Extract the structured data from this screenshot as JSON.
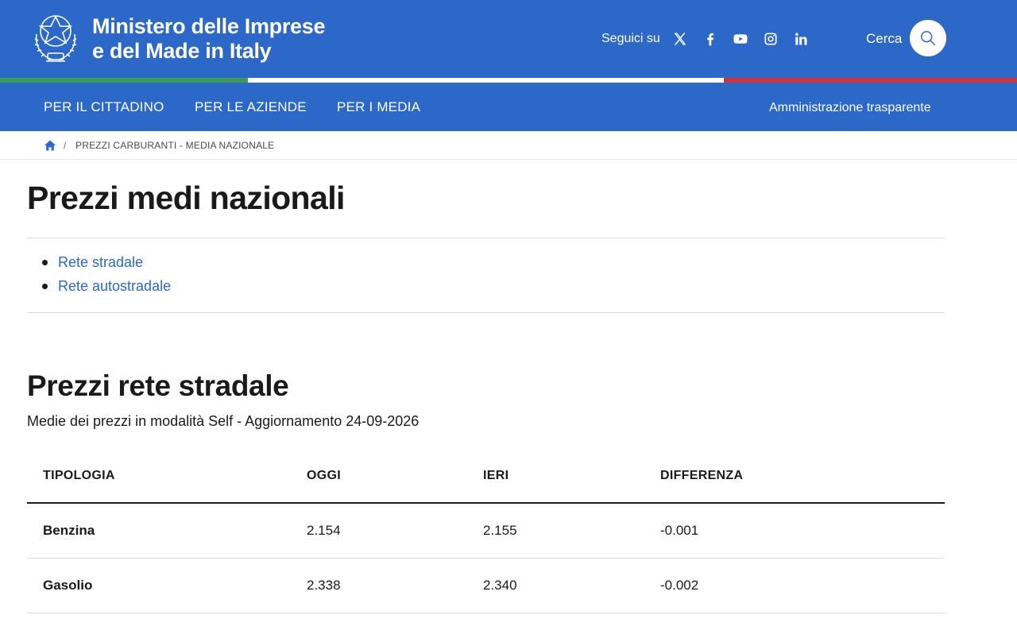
{
  "header": {
    "brand_line1": "Ministero delle Imprese",
    "brand_line2": "e del Made in Italy",
    "social_label": "Seguici su",
    "social_icons": [
      "x-icon",
      "facebook-icon",
      "youtube-icon",
      "instagram-icon",
      "linkedin-icon"
    ],
    "search_label": "Cerca"
  },
  "nav": {
    "items": [
      "PER IL CITTADINO",
      "PER LE AZIENDE",
      "PER I MEDIA"
    ],
    "right": "Amministrazione trasparente"
  },
  "breadcrumb": {
    "separator": "/",
    "current": "PREZZI CARBURANTI - MEDIA NAZIONALE"
  },
  "main": {
    "title": "Prezzi medi nazionali",
    "links": [
      "Rete stradale",
      "Rete autostradale"
    ],
    "section_title": "Prezzi rete stradale",
    "subtitle": "Medie dei prezzi in modalità Self - Aggiornamento 24-09-2026",
    "table": {
      "headers": [
        "TIPOLOGIA",
        "OGGI",
        "IERI",
        "DIFFERENZA"
      ],
      "rows": [
        [
          "Benzina",
          "2.154",
          "2.155",
          "-0.001"
        ],
        [
          "Gasolio",
          "2.338",
          "2.340",
          "-0.002"
        ]
      ]
    }
  },
  "colors": {
    "primary": "#2c68c7",
    "flag_green": "#3f9b55",
    "flag_red": "#c8363b",
    "text": "#1a1a1a"
  }
}
